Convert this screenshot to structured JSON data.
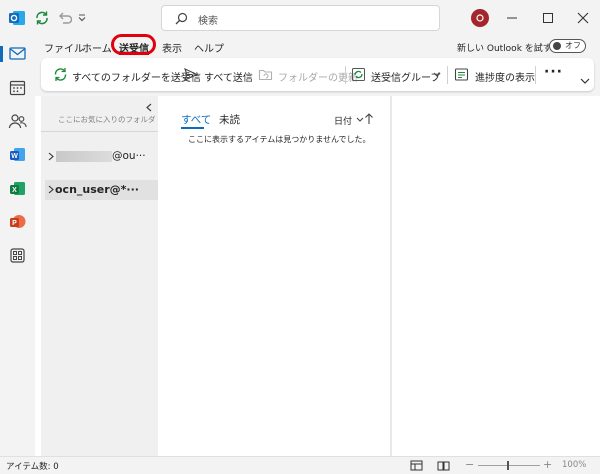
{
  "titlebar": {
    "app": "Outlook",
    "search": {
      "placeholder": "検索"
    },
    "icons": [
      "outlook-logo-icon",
      "sync-icon",
      "undo-icon",
      "qat-chevron-icon",
      "search-icon",
      "minimize-icon",
      "maximize-icon",
      "close-icon"
    ],
    "avatar": {
      "color": "#a4262c"
    }
  },
  "menu": {
    "tabs": [
      "ファイル",
      "ホーム",
      "送受信",
      "表示",
      "ヘルプ"
    ],
    "active_index": 2,
    "highlight_color": "#e0000e",
    "new_outlook_label": "新しい Outlook を試す",
    "toggle_label": "オフ"
  },
  "ribbon": {
    "send_receive_all": "すべてのフォルダーを送受信",
    "send_all": "すべて送信",
    "update_folder": "フォルダーの更新",
    "send_receive_groups": "送受信グループ",
    "show_progress": "進捗度の表示",
    "more": "···"
  },
  "rail": {
    "icons": [
      "mail-icon",
      "calendar-icon",
      "people-icon",
      "word-icon",
      "excel-icon",
      "powerpoint-icon",
      "apps-icon"
    ]
  },
  "folders": {
    "favorites_hint": "ここにお気に入りのフォルダーを",
    "accounts": [
      {
        "label": "@ou···",
        "redacted": true
      },
      {
        "label": "ocn_user@*···",
        "selected": true
      }
    ]
  },
  "messages": {
    "tabs": [
      "すべて",
      "未読"
    ],
    "active_tab": 0,
    "sort": "日付",
    "empty_text": "ここに表示するアイテムは見つかりませんでした。",
    "accent": "#0f6cbd"
  },
  "status": {
    "items_count": "アイテム数: 0",
    "zoom": "100%"
  }
}
